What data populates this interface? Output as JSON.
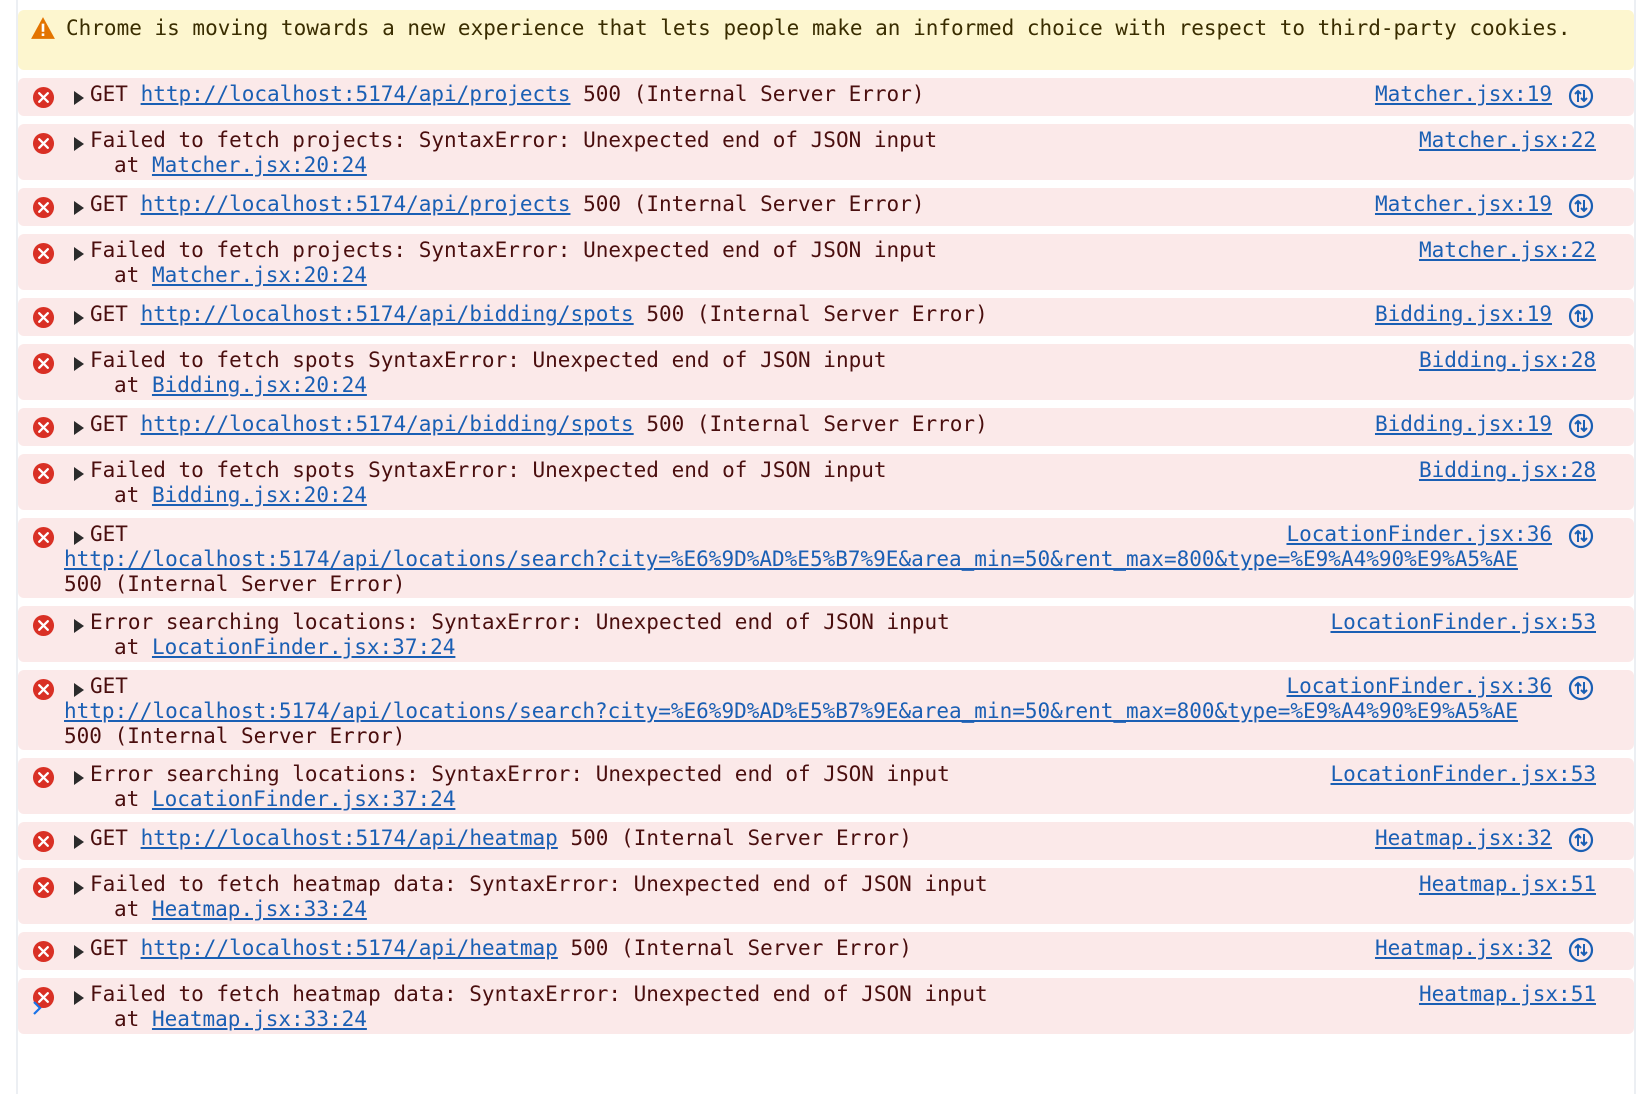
{
  "warning": {
    "text": "Chrome is moving towards a new experience that lets people make an informed choice with respect to third-party cookies."
  },
  "entries": [
    {
      "kind": "get",
      "method": "GET",
      "url": "http://localhost:5174/api/projects",
      "status": "500 (Internal Server Error)",
      "source": "Matcher.jsx:19"
    },
    {
      "kind": "fail",
      "message": "Failed to fetch projects: SyntaxError: Unexpected end of JSON input",
      "at_prefix": "at",
      "at_link": "Matcher.jsx:20:24",
      "source": "Matcher.jsx:22"
    },
    {
      "kind": "get",
      "method": "GET",
      "url": "http://localhost:5174/api/projects",
      "status": "500 (Internal Server Error)",
      "source": "Matcher.jsx:19"
    },
    {
      "kind": "fail",
      "message": "Failed to fetch projects: SyntaxError: Unexpected end of JSON input",
      "at_prefix": "at",
      "at_link": "Matcher.jsx:20:24",
      "source": "Matcher.jsx:22"
    },
    {
      "kind": "get",
      "method": "GET",
      "url": "http://localhost:5174/api/bidding/spots",
      "status": "500 (Internal Server Error)",
      "source": "Bidding.jsx:19"
    },
    {
      "kind": "fail",
      "message": "Failed to fetch spots SyntaxError: Unexpected end of JSON input",
      "at_prefix": "at",
      "at_link": "Bidding.jsx:20:24",
      "source": "Bidding.jsx:28"
    },
    {
      "kind": "get",
      "method": "GET",
      "url": "http://localhost:5174/api/bidding/spots",
      "status": "500 (Internal Server Error)",
      "source": "Bidding.jsx:19"
    },
    {
      "kind": "fail",
      "message": "Failed to fetch spots SyntaxError: Unexpected end of JSON input",
      "at_prefix": "at",
      "at_link": "Bidding.jsx:20:24",
      "source": "Bidding.jsx:28"
    },
    {
      "kind": "get-long",
      "method": "GET",
      "url": "http://localhost:5174/api/locations/search?city=%E6%9D%AD%E5%B7%9E&area_min=50&rent_max=800&type=%E9%A4%90%E9%A5%AE",
      "status": "500 (Internal Server Error)",
      "source": "LocationFinder.jsx:36"
    },
    {
      "kind": "fail",
      "message": "Error searching locations: SyntaxError: Unexpected end of JSON input",
      "at_prefix": "at",
      "at_link": "LocationFinder.jsx:37:24",
      "source": "LocationFinder.jsx:53"
    },
    {
      "kind": "get-long",
      "method": "GET",
      "url": "http://localhost:5174/api/locations/search?city=%E6%9D%AD%E5%B7%9E&area_min=50&rent_max=800&type=%E9%A4%90%E9%A5%AE",
      "status": "500 (Internal Server Error)",
      "source": "LocationFinder.jsx:36"
    },
    {
      "kind": "fail",
      "message": "Error searching locations: SyntaxError: Unexpected end of JSON input",
      "at_prefix": "at",
      "at_link": "LocationFinder.jsx:37:24",
      "source": "LocationFinder.jsx:53"
    },
    {
      "kind": "get",
      "method": "GET",
      "url": "http://localhost:5174/api/heatmap",
      "status": "500 (Internal Server Error)",
      "source": "Heatmap.jsx:32"
    },
    {
      "kind": "fail",
      "message": "Failed to fetch heatmap data: SyntaxError: Unexpected end of JSON input",
      "at_prefix": "at",
      "at_link": "Heatmap.jsx:33:24",
      "source": "Heatmap.jsx:51"
    },
    {
      "kind": "get",
      "method": "GET",
      "url": "http://localhost:5174/api/heatmap",
      "status": "500 (Internal Server Error)",
      "source": "Heatmap.jsx:32"
    },
    {
      "kind": "fail",
      "message": "Failed to fetch heatmap data: SyntaxError: Unexpected end of JSON input",
      "at_prefix": "at",
      "at_link": "Heatmap.jsx:33:24",
      "source": "Heatmap.jsx:51"
    }
  ],
  "colors": {
    "error_bg": "#fbe9e9",
    "error_icon": "#d93025",
    "warning_bg": "#fdf6cf",
    "warning_icon": "#e37400",
    "link": "#1a5fb4",
    "prompt": "#1a73e8"
  },
  "icons": {
    "error": "error-circle-icon",
    "warning": "warning-triangle-icon",
    "network": "network-request-icon",
    "expand": "expand-triangle-icon",
    "prompt": "console-prompt-chevron-icon"
  }
}
